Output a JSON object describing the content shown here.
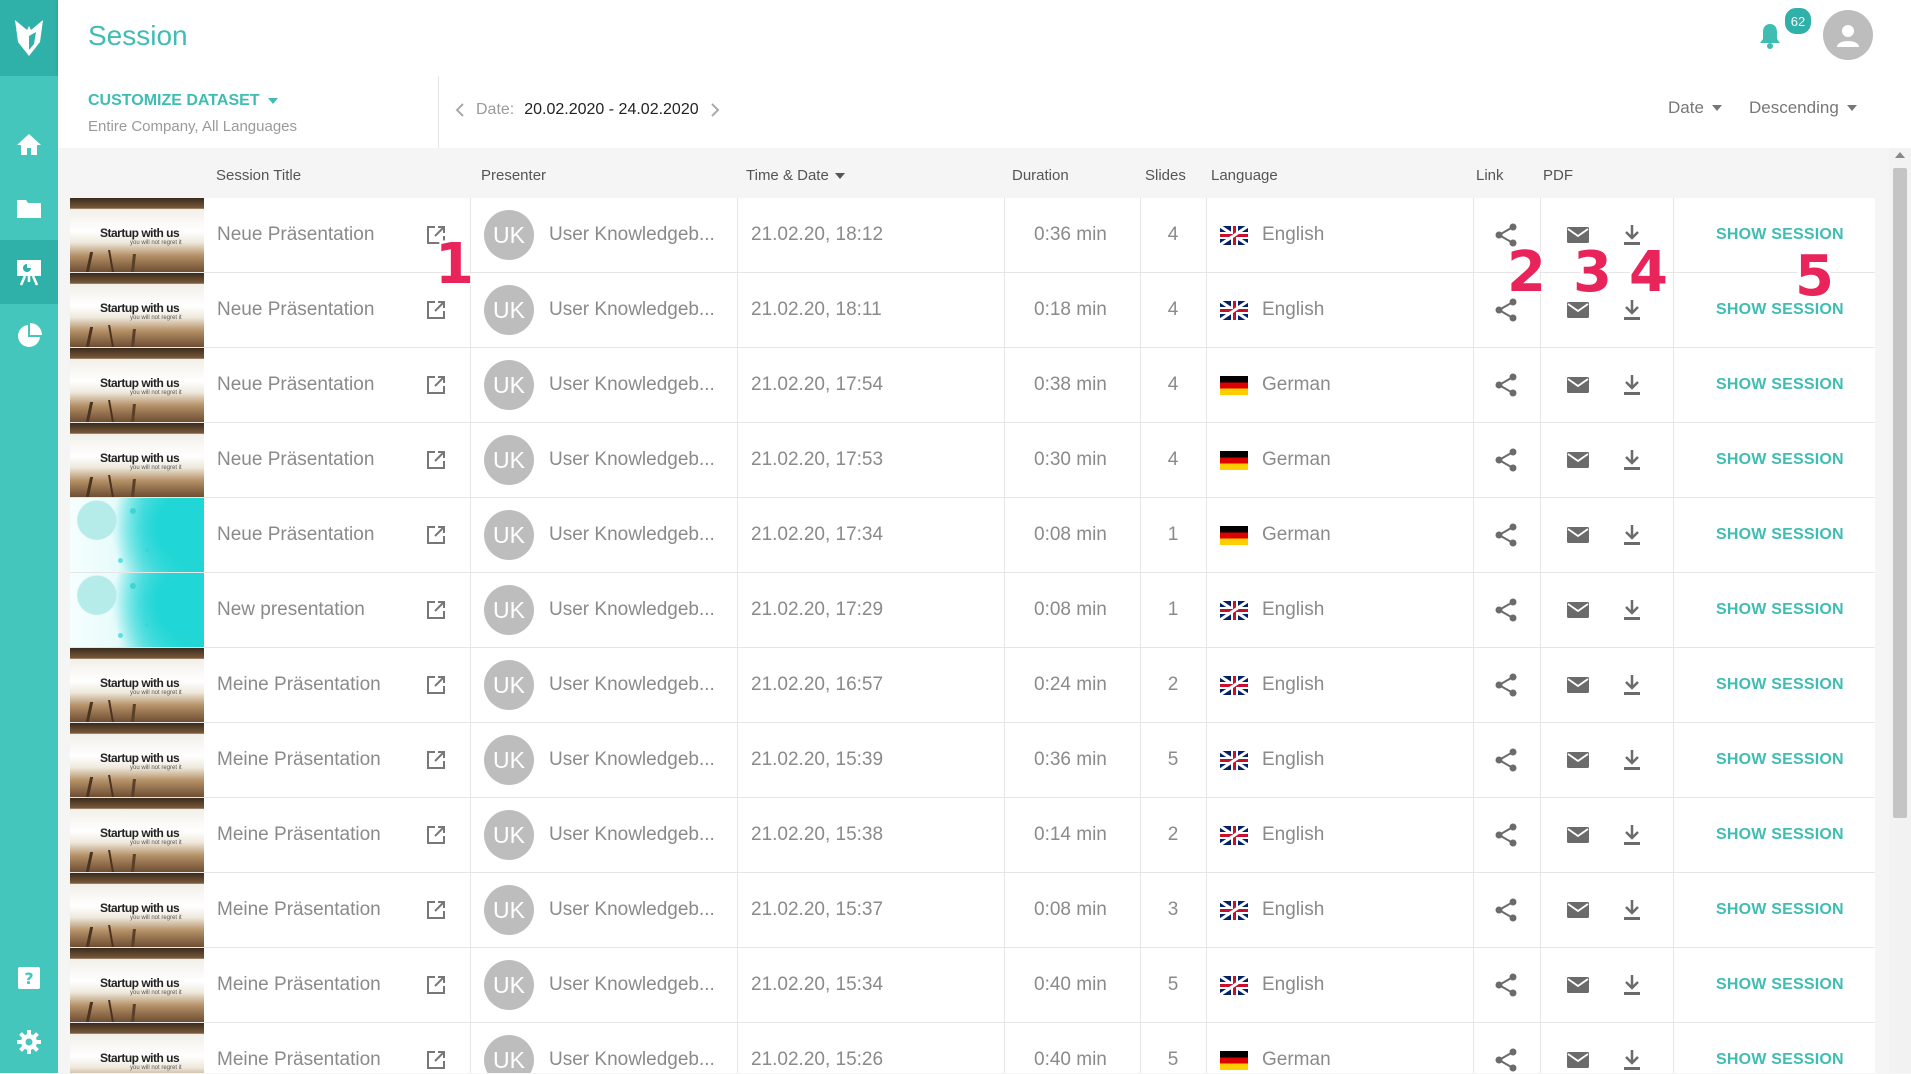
{
  "header": {
    "title": "Session",
    "notification_count": "62"
  },
  "filter": {
    "customize_label": "CUSTOMIZE DATASET",
    "scope": "Entire Company,  All Languages",
    "date_label": "Date:",
    "date_range": "20.02.2020 - 24.02.2020",
    "sort_field": "Date",
    "sort_order": "Descending"
  },
  "columns": {
    "title": "Session Title",
    "presenter": "Presenter",
    "time": "Time & Date",
    "duration": "Duration",
    "slides": "Slides",
    "language": "Language",
    "link": "Link",
    "pdf": "PDF"
  },
  "thumbs": {
    "startup_title": "Startup with us",
    "startup_sub": "you will not regret it"
  },
  "rows": [
    {
      "thumb": "startup",
      "title": "Neue Präsentation",
      "initials": "UK",
      "presenter": "User Knowledgeb...",
      "time": "21.02.20, 18:12",
      "duration": "0:36 min",
      "slides": "4",
      "lang": "English",
      "flag": "en",
      "action": "SHOW SESSION"
    },
    {
      "thumb": "startup",
      "title": "Neue Präsentation",
      "initials": "UK",
      "presenter": "User Knowledgeb...",
      "time": "21.02.20, 18:11",
      "duration": "0:18 min",
      "slides": "4",
      "lang": "English",
      "flag": "en",
      "action": "SHOW SESSION"
    },
    {
      "thumb": "startup",
      "title": "Neue Präsentation",
      "initials": "UK",
      "presenter": "User Knowledgeb...",
      "time": "21.02.20, 17:54",
      "duration": "0:38 min",
      "slides": "4",
      "lang": "German",
      "flag": "de",
      "action": "SHOW SESSION"
    },
    {
      "thumb": "startup",
      "title": "Neue Präsentation",
      "initials": "UK",
      "presenter": "User Knowledgeb...",
      "time": "21.02.20, 17:53",
      "duration": "0:30 min",
      "slides": "4",
      "lang": "German",
      "flag": "de",
      "action": "SHOW SESSION"
    },
    {
      "thumb": "teal",
      "title": "Neue Präsentation",
      "initials": "UK",
      "presenter": "User Knowledgeb...",
      "time": "21.02.20, 17:34",
      "duration": "0:08 min",
      "slides": "1",
      "lang": "German",
      "flag": "de",
      "action": "SHOW SESSION"
    },
    {
      "thumb": "teal",
      "title": "New presentation",
      "initials": "UK",
      "presenter": "User Knowledgeb...",
      "time": "21.02.20, 17:29",
      "duration": "0:08 min",
      "slides": "1",
      "lang": "English",
      "flag": "en",
      "action": "SHOW SESSION"
    },
    {
      "thumb": "startup",
      "title": "Meine Präsentation",
      "initials": "UK",
      "presenter": "User Knowledgeb...",
      "time": "21.02.20, 16:57",
      "duration": "0:24 min",
      "slides": "2",
      "lang": "English",
      "flag": "en",
      "action": "SHOW SESSION"
    },
    {
      "thumb": "startup",
      "title": "Meine Präsentation",
      "initials": "UK",
      "presenter": "User Knowledgeb...",
      "time": "21.02.20, 15:39",
      "duration": "0:36 min",
      "slides": "5",
      "lang": "English",
      "flag": "en",
      "action": "SHOW SESSION"
    },
    {
      "thumb": "startup",
      "title": "Meine Präsentation",
      "initials": "UK",
      "presenter": "User Knowledgeb...",
      "time": "21.02.20, 15:38",
      "duration": "0:14 min",
      "slides": "2",
      "lang": "English",
      "flag": "en",
      "action": "SHOW SESSION"
    },
    {
      "thumb": "startup",
      "title": "Meine Präsentation",
      "initials": "UK",
      "presenter": "User Knowledgeb...",
      "time": "21.02.20, 15:37",
      "duration": "0:08 min",
      "slides": "3",
      "lang": "English",
      "flag": "en",
      "action": "SHOW SESSION"
    },
    {
      "thumb": "startup",
      "title": "Meine Präsentation",
      "initials": "UK",
      "presenter": "User Knowledgeb...",
      "time": "21.02.20, 15:34",
      "duration": "0:40 min",
      "slides": "5",
      "lang": "English",
      "flag": "en",
      "action": "SHOW SESSION"
    },
    {
      "thumb": "startup",
      "title": "Meine Präsentation",
      "initials": "UK",
      "presenter": "User Knowledgeb...",
      "time": "21.02.20, 15:26",
      "duration": "0:40 min",
      "slides": "5",
      "lang": "German",
      "flag": "de",
      "action": "SHOW SESSION"
    }
  ],
  "annotations": [
    "1",
    "2",
    "3",
    "4",
    "5"
  ],
  "icons": {
    "logo": "fox-logo-icon",
    "home": "home-icon",
    "folder": "folder-icon",
    "presentation": "presentation-icon",
    "analytics": "pie-chart-icon",
    "help": "help-icon",
    "settings": "gear-icon",
    "bell": "bell-icon",
    "avatar": "user-avatar-icon",
    "open": "open-external-icon",
    "share": "share-icon",
    "mail": "mail-icon",
    "download": "download-icon"
  },
  "colors": {
    "accent": "#45c6bd",
    "accent_dark": "#2fb0a8",
    "annotation": "#e8245a"
  }
}
